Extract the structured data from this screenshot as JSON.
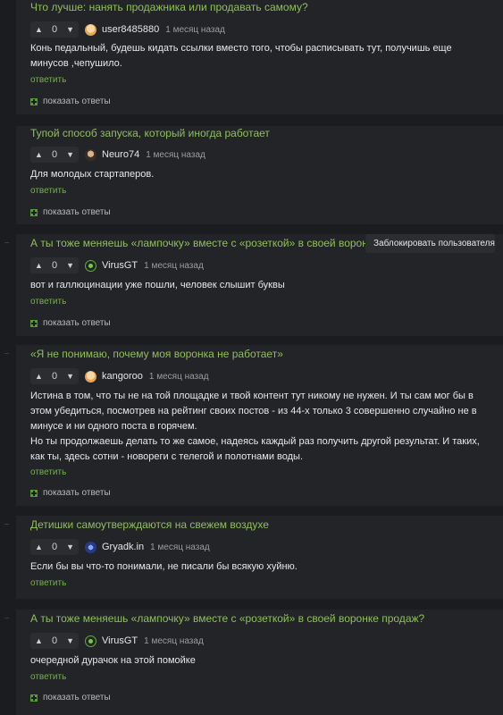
{
  "comments": [
    {
      "thread_title": "Что лучше: нанять продажника или продавать самому?",
      "votes": "0",
      "username": "user8485880",
      "time": "1 месяц назад",
      "lines": [
        "Конь педальный, будешь кидать ссылки вместо того, чтобы расписывать тут, получишь еще",
        "минусов ,чепушило."
      ],
      "reply_label": "ответить",
      "show_replies_label": "показать ответы"
    },
    {
      "thread_title": "Тупой способ запуска, который иногда работает",
      "votes": "0",
      "username": "Neuro74",
      "time": "1 месяц назад",
      "lines": [
        "Для молодых стартаперов."
      ],
      "reply_label": "ответить",
      "show_replies_label": "показать ответы"
    },
    {
      "thread_title": "А ты тоже меняешь «лампочку» вместе с «розеткой» в своей воронке продаж?",
      "votes": "0",
      "username": "VirusGT",
      "time": "1 месяц назад",
      "lines": [
        "вот и галлюцинации уже пошли, человек слышит буквы"
      ],
      "reply_label": "ответить",
      "show_replies_label": "показать ответы"
    },
    {
      "thread_title": "«Я не понимаю, почему моя воронка не работает»",
      "votes": "0",
      "username": "kangoroo",
      "time": "1 месяц назад",
      "lines": [
        "Истина в том, что ты не на той площадке и твой контент тут никому не нужен. И ты сам мог бы в",
        "этом убедиться, посмотрев на рейтинг своих постов - из 44-х только 3 совершенно случайно не в",
        "минусе и ни одного поста в горячем.",
        "Но ты продолжаешь делать то же самое, надеясь каждый раз получить другой результат. И таких,",
        "как ты, здесь сотни - новореги с телегой и полотнами воды."
      ],
      "reply_label": "ответить",
      "show_replies_label": "показать ответы"
    },
    {
      "thread_title": "Детишки самоутверждаются на свежем воздухе",
      "votes": "0",
      "username": "Gryadk.in",
      "time": "1 месяц назад",
      "lines": [
        "Если бы вы что-то понимали, не писали бы всякую хуйню."
      ],
      "reply_label": "ответить"
    },
    {
      "thread_title": "А ты тоже меняешь «лампочку» вместе с «розеткой» в своей воронке продаж?",
      "votes": "0",
      "username": "VirusGT",
      "time": "1 месяц назад",
      "lines": [
        "очередной дурачок на этой помойке"
      ],
      "reply_label": "ответить",
      "show_replies_label": "показать ответы"
    }
  ],
  "tooltip": "Заблокировать пользователя",
  "icons": {
    "upvote": "arrow-up-icon",
    "downvote": "arrow-down-icon",
    "show_replies": "plus-box-icon"
  },
  "colors": {
    "background": "#1b1c1f",
    "card": "#232427",
    "accent_green": "#8fbf5b",
    "text": "#e6e7e9"
  }
}
